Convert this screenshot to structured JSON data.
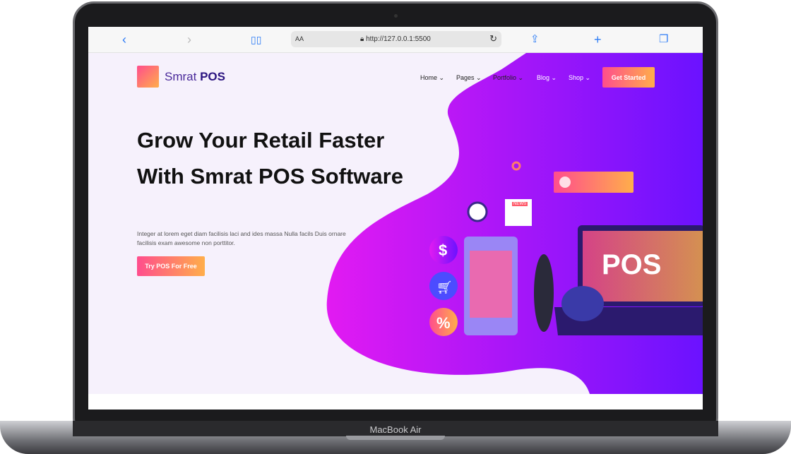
{
  "browser": {
    "url": "http://127.0.0.1:5500",
    "text_size": "AA"
  },
  "header": {
    "logo_light": "Smrat ",
    "logo_bold": "POS",
    "nav": [
      "Home",
      "Pages",
      "Portfolio",
      "Blog",
      "Shop"
    ],
    "cta": "Get Started"
  },
  "hero": {
    "title": "Grow Your Retail Faster With Smrat POS Software",
    "description": "Integer at lorem eget diam facilisis laci and ides massa Nulla facils Duis ornare facilisis exam awesome non porttitor.",
    "button": "Try POS For Free",
    "screen_text": "POS",
    "news_label": "NEWS"
  },
  "device": {
    "label": "MacBook Air"
  }
}
